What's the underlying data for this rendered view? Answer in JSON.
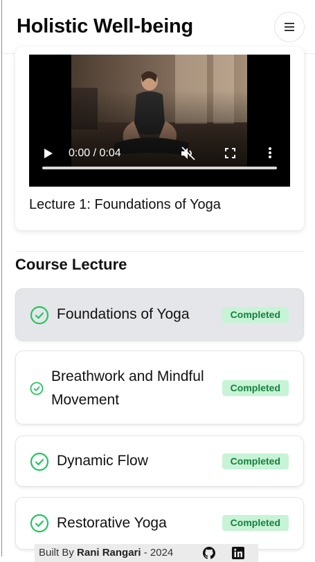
{
  "header": {
    "title": "Holistic Well-being",
    "menu_icon": "menu-icon"
  },
  "player": {
    "time": "0:00 / 0:04",
    "progress": 0,
    "icons": [
      "play-icon",
      "volume-muted-icon",
      "fullscreen-icon",
      "more-vert-icon"
    ],
    "current_lecture": "Lecture 1: Foundations of Yoga"
  },
  "course": {
    "section_title": "Course Lecture",
    "lessons": [
      {
        "label": "Foundations of Yoga",
        "status": "Completed",
        "active": true
      },
      {
        "label_line1": "Breathwork and Mindful",
        "label_line2": "Movement",
        "status": "Completed",
        "active": false
      },
      {
        "label": "Dynamic Flow",
        "status": "Completed",
        "active": false
      },
      {
        "label": "Restorative Yoga",
        "status": "Completed",
        "active": false
      }
    ]
  },
  "footer": {
    "built_by": "Built By",
    "author": "Rani Rangari",
    "year": "- 2024",
    "icons": [
      "github-icon",
      "linkedin-icon"
    ]
  },
  "colors": {
    "accent_green": "#22c55e",
    "badge_bg": "#c7f3d6",
    "badge_text": "#15803d",
    "active_row_bg": "#e5e6e9"
  }
}
